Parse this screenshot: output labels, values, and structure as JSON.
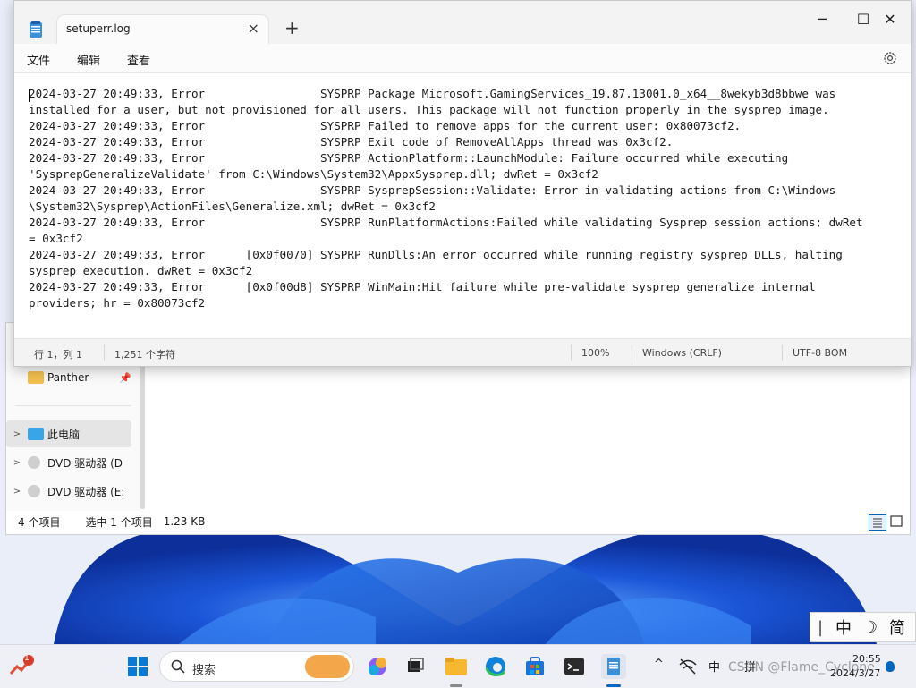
{
  "notepad": {
    "tab_title": "setuperr.log",
    "new_tab": "+",
    "controls": {
      "minimize": "─",
      "maximize": "☐",
      "close": "✕"
    },
    "menu": [
      "文件",
      "编辑",
      "查看"
    ],
    "content_lines": [
      "2024-03-27 20:49:33, Error                 SYSPRP Package Microsoft.GamingServices_19.87.13001.0_x64__8wekyb3d8bbwe was",
      "installed for a user, but not provisioned for all users. This package will not function properly in the sysprep image.",
      "2024-03-27 20:49:33, Error                 SYSPRP Failed to remove apps for the current user: 0x80073cf2.",
      "2024-03-27 20:49:33, Error                 SYSPRP Exit code of RemoveAllApps thread was 0x3cf2.",
      "2024-03-27 20:49:33, Error                 SYSPRP ActionPlatform::LaunchModule: Failure occurred while executing",
      "'SysprepGeneralizeValidate' from C:\\Windows\\System32\\AppxSysprep.dll; dwRet = 0x3cf2",
      "2024-03-27 20:49:33, Error                 SYSPRP SysprepSession::Validate: Error in validating actions from C:\\Windows",
      "\\System32\\Sysprep\\ActionFiles\\Generalize.xml; dwRet = 0x3cf2",
      "2024-03-27 20:49:33, Error                 SYSPRP RunPlatformActions:Failed while validating Sysprep session actions; dwRet",
      "= 0x3cf2",
      "2024-03-27 20:49:33, Error      [0x0f0070] SYSPRP RunDlls:An error occurred while running registry sysprep DLLs, halting",
      "sysprep execution. dwRet = 0x3cf2",
      "2024-03-27 20:49:33, Error      [0x0f00d8] SYSPRP WinMain:Hit failure while pre-validate sysprep generalize internal",
      "providers; hr = 0x80073cf2"
    ],
    "status": {
      "position": "行 1，列 1",
      "char_count": "1,251 个字符",
      "zoom": "100%",
      "line_ending": "Windows (CRLF)",
      "encoding": "UTF-8 BOM"
    }
  },
  "explorer": {
    "nav_items": [
      {
        "label": "Panther",
        "pinned": true
      },
      {
        "label": "此电脑"
      },
      {
        "label": "DVD 驱动器 (D"
      },
      {
        "label": "DVD 驱动器 (E:"
      }
    ],
    "status": {
      "item_count": "4 个项目",
      "selected": "选中 1 个项目",
      "size": "1.23 KB"
    }
  },
  "ime": {
    "cursor": "|",
    "mode": "中",
    "moon": "☽",
    "script": "简"
  },
  "taskbar": {
    "search_label": "搜索",
    "notification_badge": "1",
    "tray": {
      "input_lang": "中",
      "input_mode": "拼"
    },
    "clock": {
      "time": "20:55",
      "date": "2024/3/27"
    },
    "watermark": "CSDN @Flame_Cyclone"
  },
  "colors": {
    "accent": "#0067c0",
    "wallpaper_blue": "#1d4fbf"
  }
}
